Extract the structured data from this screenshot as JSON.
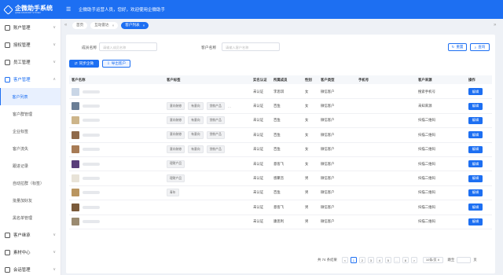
{
  "app": {
    "logo_name": "企微助手系统",
    "logo_sub": "QIWEI ASSISTANT SYSTEM",
    "welcome": "企微助手运营人员，您好，欢迎使用企微助手"
  },
  "sidebar": {
    "items": [
      {
        "label": "账户管理",
        "icon": "account-icon",
        "expanded": false
      },
      {
        "label": "授权管理",
        "icon": "authorize-icon",
        "expanded": false
      },
      {
        "label": "员工管理",
        "icon": "employee-icon",
        "expanded": false
      },
      {
        "label": "客户管理",
        "icon": "customer-icon",
        "expanded": true
      }
    ],
    "subitems": [
      {
        "label": "客户列表",
        "active": true
      },
      {
        "label": "客户群管理",
        "active": false
      },
      {
        "label": "企业标签",
        "active": false
      },
      {
        "label": "客户流失",
        "active": false
      },
      {
        "label": "跟进记录",
        "active": false
      },
      {
        "label": "自动拉群（标签）",
        "active": false
      },
      {
        "label": "批量加好友",
        "active": false
      },
      {
        "label": "黑名单管理",
        "active": false
      }
    ],
    "bottom_items": [
      {
        "label": "客户继承",
        "icon": "inherit-icon"
      },
      {
        "label": "素材中心",
        "icon": "material-icon"
      },
      {
        "label": "会话管理",
        "icon": "session-icon"
      }
    ]
  },
  "tabs": [
    {
      "label": "首页",
      "active": false
    },
    {
      "label": "互动雷达",
      "active": false
    },
    {
      "label": "客户列表",
      "active": true
    }
  ],
  "search": {
    "member_label": "成员名称",
    "member_placeholder": "请输入成员名称",
    "customer_label": "客户名称",
    "customer_placeholder": "请输入客户名称",
    "reset_label": "重置",
    "search_label": "查询"
  },
  "toolbar": {
    "sync_label": "同步企微",
    "export_label": "导出客户"
  },
  "table": {
    "headers": [
      "客户名称",
      "客户标签",
      "实名认证",
      "所属成员",
      "性别",
      "客户类型",
      "手机号",
      "客户来源",
      "操作"
    ],
    "edit_label": "编辑",
    "rows": [
      {
        "avatar_color": "#c9d6e6",
        "tags": [],
        "more": false,
        "real": "未认证",
        "owner": "李思琪",
        "sex": "女",
        "type": "微信客户",
        "phone": "",
        "source": "搜索手机号"
      },
      {
        "avatar_color": "#6b7e95",
        "tags": [
          "意向装修",
          "有意向",
          "贷款产品"
        ],
        "more": true,
        "real": "未认证",
        "owner": "百鱼",
        "sex": "女",
        "type": "微信客户",
        "phone": "",
        "source": "未知来源"
      },
      {
        "avatar_color": "#cdb58a",
        "tags": [
          "意向装修",
          "有意向",
          "贷款产品"
        ],
        "more": false,
        "real": "未认证",
        "owner": "百鱼",
        "sex": "女",
        "type": "微信客户",
        "phone": "",
        "source": "扫描二维码"
      },
      {
        "avatar_color": "#8f6a4a",
        "tags": [
          "意向装修",
          "有意向",
          "贷款产品"
        ],
        "more": false,
        "real": "未认证",
        "owner": "百鱼",
        "sex": "女",
        "type": "微信客户",
        "phone": "",
        "source": "扫描二维码"
      },
      {
        "avatar_color": "#a77b55",
        "tags": [
          "意向装修",
          "有意向",
          "贷款产品"
        ],
        "more": false,
        "real": "未认证",
        "owner": "百鱼",
        "sex": "女",
        "type": "微信客户",
        "phone": "",
        "source": "扫描二维码"
      },
      {
        "avatar_color": "#5a3f7a",
        "tags": [
          "理财产品"
        ],
        "more": false,
        "real": "未认证",
        "owner": "意客飞",
        "sex": "女",
        "type": "微信客户",
        "phone": "",
        "source": "扫描二维码"
      },
      {
        "avatar_color": "#e8e3d8",
        "tags": [
          "理财产品"
        ],
        "more": false,
        "real": "未认证",
        "owner": "感聚音",
        "sex": "男",
        "type": "微信客户",
        "phone": "",
        "source": "扫描二维码"
      },
      {
        "avatar_color": "#b99560",
        "tags": [
          "青年"
        ],
        "more": false,
        "real": "未认证",
        "owner": "百鱼",
        "sex": "男",
        "type": "微信客户",
        "phone": "",
        "source": "扫描二维码"
      },
      {
        "avatar_color": "#7a5a3a",
        "tags": [],
        "more": false,
        "real": "未认证",
        "owner": "意客飞",
        "sex": "男",
        "type": "微信客户",
        "phone": "",
        "source": "扫描二维码"
      },
      {
        "avatar_color": "#9a8a70",
        "tags": [],
        "more": false,
        "real": "未认证",
        "owner": "康思利",
        "sex": "男",
        "type": "微信客户",
        "phone": "",
        "source": "扫描二维码"
      }
    ]
  },
  "pagination": {
    "total_text": "共 74 条结果",
    "prev": "<",
    "pages": [
      "1",
      "2",
      "3",
      "4",
      "5",
      "...",
      "8"
    ],
    "active_page": "1",
    "next": ">",
    "page_size": "10条/页",
    "jump_label": "跳至",
    "page_unit": "页"
  }
}
